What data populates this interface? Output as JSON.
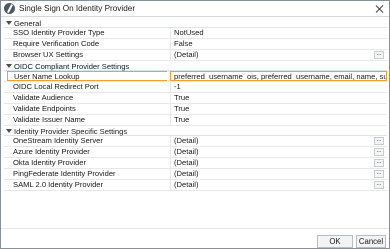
{
  "window": {
    "title": "Single Sign On Identity Provider"
  },
  "sections": [
    {
      "label": "General",
      "rows": [
        {
          "name": "SSO Identity Provider Type",
          "value": "NotUsed",
          "ellipsis": false
        },
        {
          "name": "Require Verification Code",
          "value": "False",
          "ellipsis": false
        },
        {
          "name": "Browser UX Settings",
          "value": "(Detail)",
          "ellipsis": true
        }
      ]
    },
    {
      "label": "OIDC Compliant Provider Settings",
      "rows": [
        {
          "name": "User Name Lookup",
          "value": "preferred_username_ois, preferred_username, email, name, sub, aud",
          "ellipsis": false,
          "selected": true
        },
        {
          "name": "OIDC Local Redirect Port",
          "value": "-1",
          "ellipsis": false
        },
        {
          "name": "Validate Audience",
          "value": "True",
          "ellipsis": false
        },
        {
          "name": "Validate Endpoints",
          "value": "True",
          "ellipsis": false
        },
        {
          "name": "Validate Issuer Name",
          "value": "True",
          "ellipsis": false
        }
      ]
    },
    {
      "label": "Identity Provider Specific Settings",
      "rows": [
        {
          "name": "OneStream Identity Server",
          "value": "(Detail)",
          "ellipsis": true
        },
        {
          "name": "Azure Identity Provider",
          "value": "(Detail)",
          "ellipsis": true
        },
        {
          "name": "Okta Identity Provider",
          "value": "(Detail)",
          "ellipsis": true
        },
        {
          "name": "PingFederate Identity Provider",
          "value": "(Detail)",
          "ellipsis": true
        },
        {
          "name": "SAML 2.0 Identity Provider",
          "value": "(Detail)",
          "ellipsis": true
        }
      ]
    }
  ],
  "footer": {
    "ok_label": "OK",
    "cancel_label": "Cancel"
  },
  "ellipsis_label": "..."
}
